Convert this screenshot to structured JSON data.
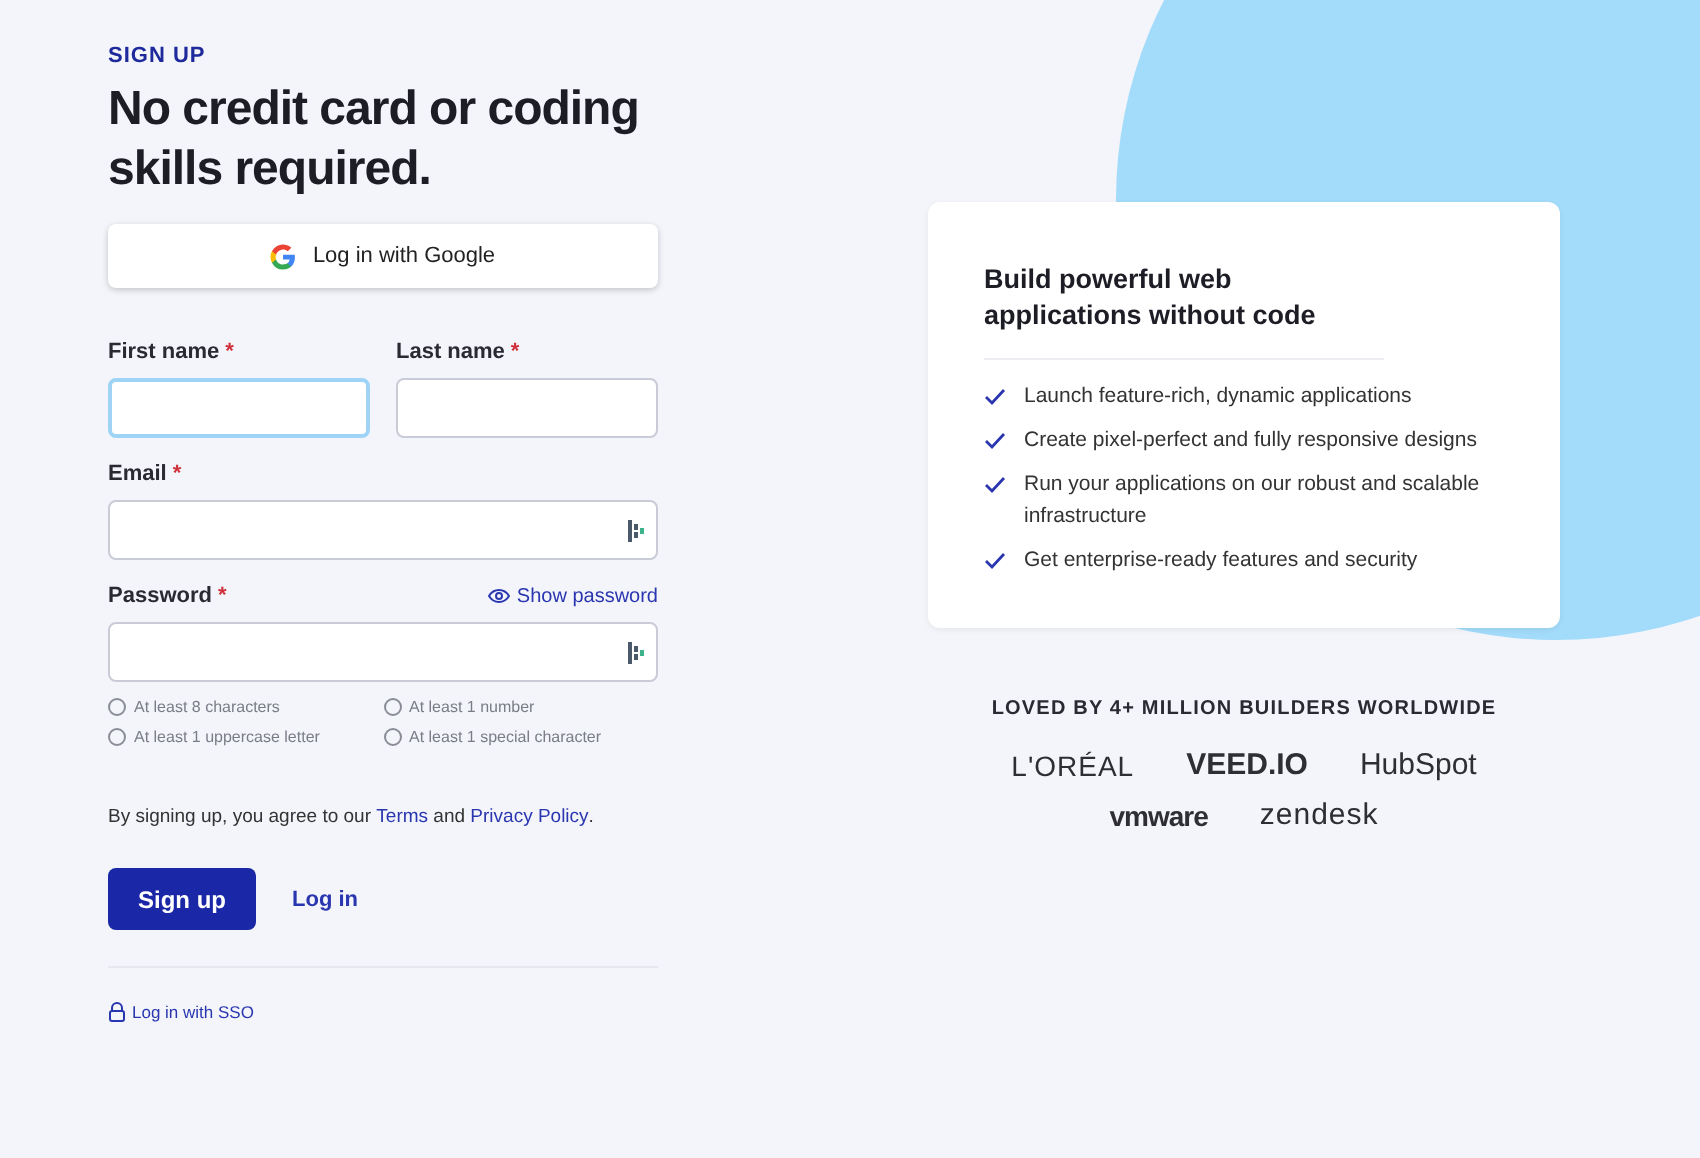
{
  "eyebrow": "SIGN UP",
  "heading": "No credit card or coding skills required.",
  "google_button": "Log in with Google",
  "fields": [
    {
      "kind": "name",
      "label": "First name",
      "required": "*",
      "focused": true
    },
    {
      "kind": "name",
      "label": "Last name",
      "required": "*",
      "focused": false
    },
    {
      "kind": "email",
      "label": "Email",
      "required": "*",
      "focused": false
    },
    {
      "kind": "password",
      "label": "Password",
      "required": "*",
      "focused": false,
      "action": "Show password"
    }
  ],
  "requirements": [
    {
      "text": "At least 8 characters",
      "met": false
    },
    {
      "text": "At least 1 number",
      "met": false
    },
    {
      "text": "At least 1 uppercase letter",
      "met": false
    },
    {
      "text": "At least 1 special character",
      "met": false
    }
  ],
  "agreement": {
    "before": "By signing up, you agree to our",
    "terms": "Terms",
    "and": "and",
    "privacy": "Privacy Policy",
    "end": "."
  },
  "signup_button": "Sign up",
  "login_link": "Log in",
  "sso_link": "Log in with SSO",
  "card": {
    "title": "Build powerful web applications without code",
    "features": [
      "Launch feature-rich, dynamic applications",
      "Create pixel-perfect and fully responsive designs",
      "Run your applications on our robust and scalable infrastructure",
      "Get enterprise-ready features and security"
    ]
  },
  "social_proof": "LOVED BY 4+ MILLION BUILDERS WORLDWIDE",
  "logos": [
    [
      "L'ORÉAL",
      "VEED.IO",
      "HubSpot"
    ],
    [
      "vmware",
      "zendesk"
    ]
  ]
}
